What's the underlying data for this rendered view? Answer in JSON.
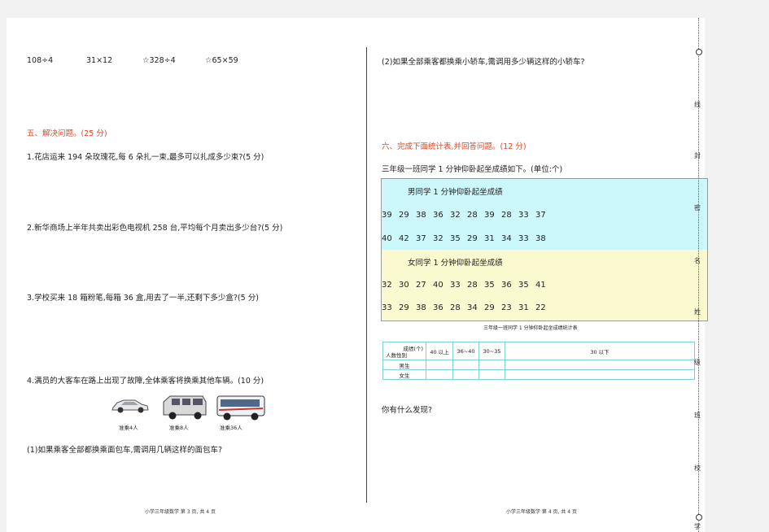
{
  "left": {
    "calcs": [
      "108÷4",
      "31×12",
      "☆328÷4",
      "☆65×59"
    ],
    "section5_title": "五、解决问题。(25 分)",
    "q1": "1.花店运来 194 朵玫瑰花,每 6 朵扎一束,最多可以扎成多少束?(5 分)",
    "q2": "2.新华商场上半年共卖出彩色电视机 258 台,平均每个月卖出多少台?(5 分)",
    "q3": "3.学校买来 18 箱粉笔,每箱 36 盒,用去了一半,还剩下多少盒?(5 分)",
    "q4": "4.满员的大客车在路上出现了故障,全体乘客将换乘其他车辆。(10 分)",
    "car_labels": [
      "准乘4人",
      "准乘8人",
      "准乘36人"
    ],
    "q4_1": "(1)如果乘客全部都换乘面包车,需调用几辆这样的面包车?",
    "footer": "小学三年级数学  第 3 页, 共 4 页"
  },
  "right": {
    "q4_2": "(2)如果全部乘客都换乘小轿车,需调用多少辆这样的小轿车?",
    "section6_title": "六、完成下面统计表,并回答问题。(12 分)",
    "intro": "三年级一班同学 1 分钟仰卧起坐成绩如下。(单位:个)",
    "boys_title": "男同学 1 分钟仰卧起坐成绩",
    "boys_row1": [
      "39",
      "29",
      "38",
      "36",
      "32",
      "28",
      "39",
      "28",
      "33",
      "37"
    ],
    "boys_row2": [
      "40",
      "42",
      "37",
      "32",
      "35",
      "29",
      "31",
      "34",
      "33",
      "38"
    ],
    "girls_title": "女同学 1 分钟仰卧起坐成绩",
    "girls_row1": [
      "32",
      "30",
      "27",
      "40",
      "33",
      "28",
      "35",
      "36",
      "35",
      "41"
    ],
    "girls_row2": [
      "33",
      "29",
      "38",
      "36",
      "28",
      "34",
      "29",
      "23",
      "31",
      "22"
    ],
    "table_title": "三年级一班同学 1 分钟仰卧起坐成绩统计表",
    "table": {
      "corner_top": "成绩(个)",
      "corner_bottom": "人数性别",
      "headers": [
        "40 以上",
        "36~40",
        "30~35",
        "30 以下"
      ],
      "rows": [
        "男生",
        "女生"
      ]
    },
    "question": "你有什么发现?",
    "footer": "小学三年级数学  第 4 页, 共 4 页"
  },
  "binding": {
    "chars": [
      "线",
      "封",
      "密",
      "名",
      "姓",
      "级",
      "班",
      "校",
      "学"
    ]
  }
}
